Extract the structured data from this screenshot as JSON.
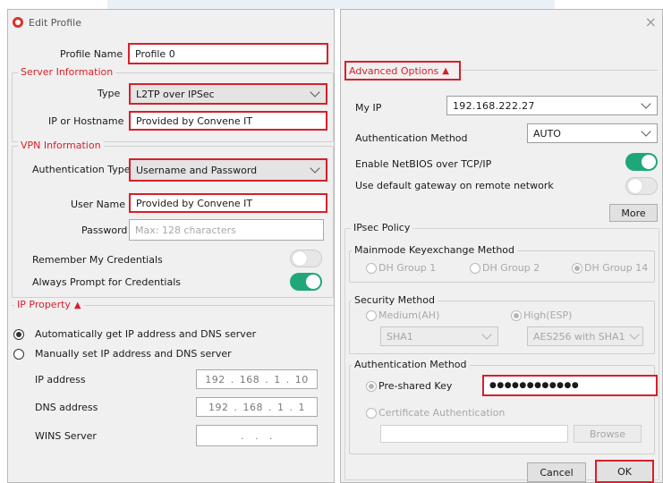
{
  "left": {
    "title": "Edit Profile",
    "profile_name_label": "Profile Name",
    "profile_name_value": "Profile 0",
    "server_info": {
      "legend": "Server Information",
      "type_label": "Type",
      "type_value": "L2TP over IPSec",
      "host_label": "IP or Hostname",
      "host_value": "Provided by Convene IT"
    },
    "vpn_info": {
      "legend": "VPN Information",
      "auth_type_label": "Authentication Type",
      "auth_type_value": "Username and Password",
      "user_label": "User Name",
      "user_value": "Provided by Convene IT",
      "password_label": "Password",
      "password_placeholder": "Max: 128 characters",
      "remember_label": "Remember My Credentials",
      "remember_on": false,
      "prompt_label": "Always Prompt for Credentials",
      "prompt_on": true
    },
    "ip_property": {
      "legend": "IP Property",
      "legend_icon": "▲",
      "auto_label": "Automatically get IP address and DNS server",
      "manual_label": "Manually set IP address and DNS server",
      "selected": "auto",
      "ip_label": "IP address",
      "ip_value": [
        "192",
        "168",
        "1",
        "10"
      ],
      "dns_label": "DNS address",
      "dns_value": [
        "192",
        "168",
        "1",
        "1"
      ],
      "wins_label": "WINS Server",
      "wins_value": [
        "",
        "",
        "",
        ""
      ]
    }
  },
  "right": {
    "close_icon": "×",
    "advanced_legend": "Advanced Options",
    "advanced_icon": "▲",
    "my_ip_label": "My IP",
    "my_ip_value": "192.168.222.27",
    "auth_method_label": "Authentication Method",
    "auth_method_value": "AUTO",
    "netbios_label": "Enable NetBIOS over TCP/IP",
    "netbios_on": true,
    "gateway_label": "Use default gateway on remote network",
    "gateway_on": false,
    "more_label": "More",
    "ipsec_legend": "IPsec Policy",
    "mainmode": {
      "legend": "Mainmode Keyexchange Method",
      "options": [
        "DH Group 1",
        "DH Group 2",
        "DH Group 14"
      ],
      "selected": "DH Group 14"
    },
    "security": {
      "legend": "Security Method",
      "medium_label": "Medium(AH)",
      "high_label": "High(ESP)",
      "selected": "High(ESP)",
      "medium_select": "SHA1",
      "high_select": "AES256 with SHA1"
    },
    "auth": {
      "legend": "Authentication Method",
      "psk_label": "Pre-shared Key",
      "psk_value": "●●●●●●●●●●●●",
      "cert_label": "Certificate Authentication",
      "selected": "Pre-shared Key",
      "browse_label": "Browse"
    },
    "cancel_label": "Cancel",
    "ok_label": "OK"
  },
  "colors": {
    "highlight": "#d81f2a",
    "toggle_on": "#1fa77a",
    "panel_bg": "#f0f0f0"
  }
}
